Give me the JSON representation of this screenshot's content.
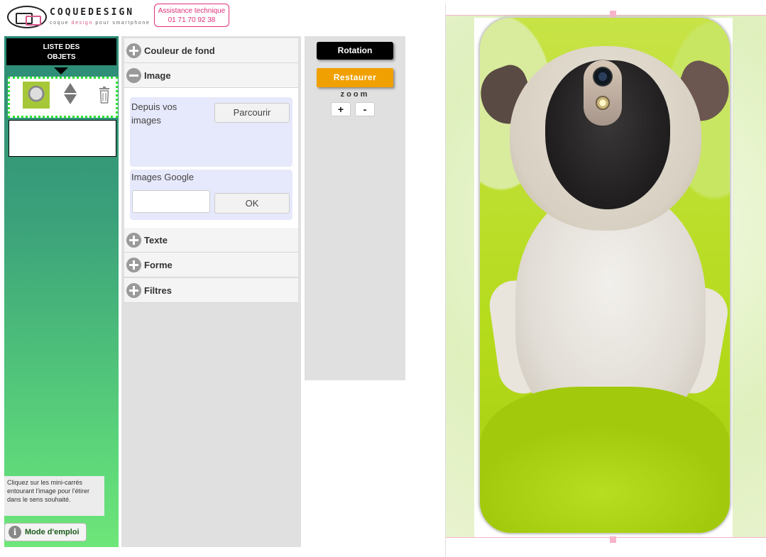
{
  "header": {
    "brand": "COQUEDESIGN",
    "tagline_parts": [
      "coque ",
      "design",
      " pour smartphone"
    ],
    "assistance_title": "Assistance technique",
    "assistance_phone": "01 71 70 92 38"
  },
  "objects_panel": {
    "title_line1": "LISTE DES",
    "title_line2": "OBJETS",
    "hint": "Cliquez sur les mini-carrés entourant l'image pour l'étirer dans le sens souhaité.",
    "manual_button": "Mode d'emploi",
    "icons": [
      "info-icon",
      "arrow-up-icon",
      "arrow-down-icon",
      "trash-icon"
    ]
  },
  "accordion": {
    "background_color": "Couleur de fond",
    "image": "Image",
    "text": "Texte",
    "shape": "Forme",
    "filters": "Filtres",
    "upload_label": "Depuis vos images",
    "browse_button": "Parcourir",
    "google_label": "Images Google",
    "google_placeholder": "",
    "ok_button": "OK"
  },
  "tools": {
    "rotation": "Rotation",
    "restore": "Restaurer",
    "zoom_label": "zoom",
    "zoom_in": "+",
    "zoom_out": "-"
  },
  "colors": {
    "accent_pink": "#e0307a",
    "restore_orange": "#f0a000",
    "panel_green": "#5bd47a"
  }
}
